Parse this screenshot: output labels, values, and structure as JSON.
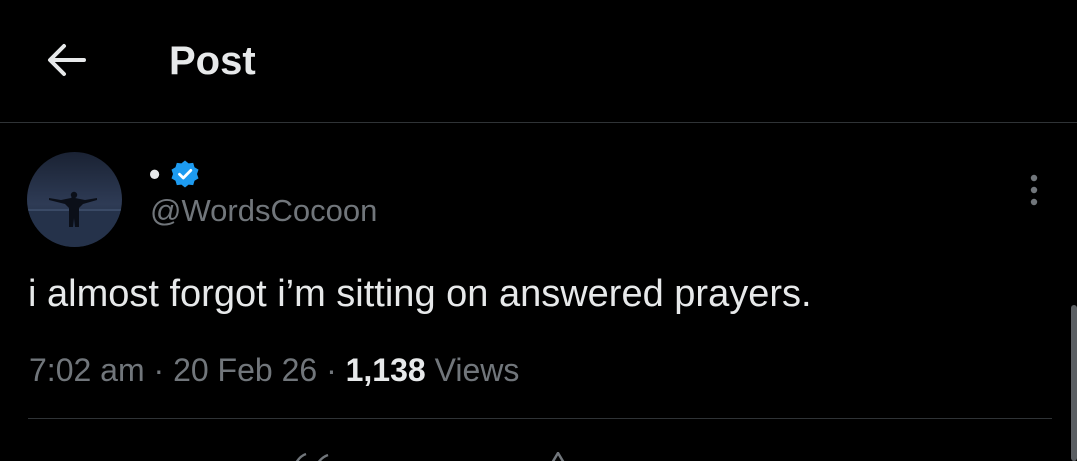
{
  "header": {
    "back_icon": "arrow-left-icon",
    "title": "Post"
  },
  "author": {
    "display_name": "•",
    "verified_icon": "verified-badge-icon",
    "verified_color": "#1d9bf0",
    "handle": "@WordsCocoon"
  },
  "more_icon": "more-vertical-icon",
  "tweet": {
    "text": "i almost forgot i’m sitting on answered prayers."
  },
  "meta": {
    "time": "7:02 am",
    "sep1": " · ",
    "date": "20 Feb 26",
    "sep2": " · ",
    "views_count": "1,138",
    "views_label": " Views"
  },
  "colors": {
    "background": "#000000",
    "primary_text": "#e7e9ea",
    "secondary_text": "#71767b",
    "divider": "#2f3336",
    "accent": "#1d9bf0"
  }
}
